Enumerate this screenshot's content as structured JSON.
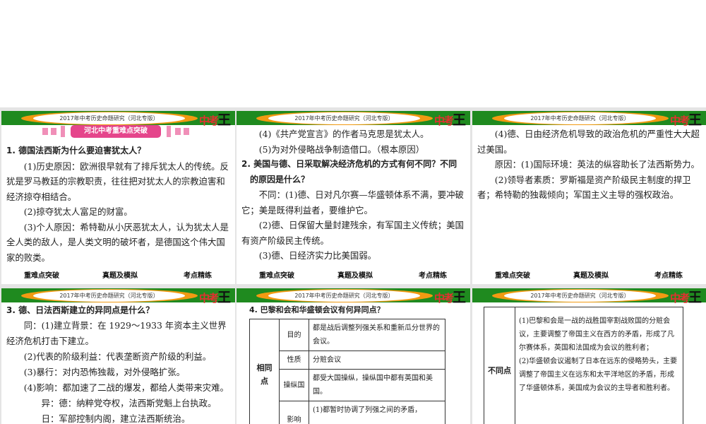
{
  "header_title": "2017年中考历史命题研究（河北专版）",
  "logo_text": {
    "a": "中考",
    "b": "王"
  },
  "footer": {
    "nav1": "重难点突破",
    "nav2": "真题及模拟",
    "nav3": "考点精练"
  },
  "slide1": {
    "banner": "河北中考重难点突破",
    "q": "1. 德国法西斯为什么要迫害犹太人？",
    "p1": "(1)历史原因：欧洲很早就有了排斥犹太人的传统。反犹是罗马教廷的宗教职责，往往把对犹太人的宗教迫害和经济掠夺相结合。",
    "p2": "(2)掠夺犹太人富足的财富。",
    "p3": "(3)个人原因：希特勒从小厌恶犹太人，认为犹太人是全人类的敌人，是人类文明的破坏者，是德国这个伟大国家的败类。"
  },
  "slide2": {
    "p1": "(4)《共产党宣言》的作者马克思是犹太人。",
    "p2": "(5)为对外侵略战争制造借口。（根本原因）",
    "q": "2. 美国与德、日采取解决经济危机的方式有何不同？不同的原因是什么？",
    "p3": "不同：(1)德、日对凡尔赛—华盛顿体系不满，要冲破它；美是既得利益者，要维护它。",
    "p4": "(2)德、日保留大量封建残余，有军国主义传统；美国有资产阶级民主传统。",
    "p5": "(3)德、日经济实力比美国弱。"
  },
  "slide3": {
    "p1": "(4)德、日由经济危机导致的政治危机的严重性大大超过美国。",
    "p2": "原因：(1)国际环境：英法的纵容助长了法西斯势力。",
    "p3": "(2)领导者素质：罗斯福是资产阶级民主制度的捍卫者；希特勒的独裁倾向；军国主义主导的强权政治。"
  },
  "slide4": {
    "q": "3. 德、日法西斯建立的异同点是什么？",
    "p1": "同：(1)建立背景：在 1929～1933 年资本主义世界经济危机打击下建立。",
    "p2": "(2)代表的阶级利益：代表垄断资产阶级的利益。",
    "p3": "(3)暴行：对内恐怖独裁，对外侵略扩张。",
    "p4": "(4)影响：都加速了二战的爆发，都给人类带来灾难。",
    "p5": "异：德：纳粹党夺权，法西斯党魁上台执政。",
    "p6": "日：军部控制内阁，建立法西斯统治。"
  },
  "slide5": {
    "q": "4. 巴黎和会和华盛顿会议有何异同点？",
    "group": "相同点",
    "rows": [
      {
        "k": "目的",
        "v": "都是战后调整列强关系和重新瓜分世界的会议。"
      },
      {
        "k": "性质",
        "v": "分赃会议"
      },
      {
        "k": "操纵国",
        "v": "都受大国操纵，操纵国中都有英国和美国。"
      },
      {
        "k": "影响",
        "v": "(1)都暂时协调了列强之间的矛盾，"
      }
    ]
  },
  "slide6": {
    "group": "不同点",
    "v1": "(1)巴黎和会是一战的战胜国宰割战败国的分赃会议，主要调整了帝国主义在西方的矛盾，形成了凡尔赛体系，英国和法国成为会议的胜利者；",
    "v2": "(2)华盛顿会议遏制了日本在远东的侵略势头，主要调整了帝国主义在远东和太平洋地区的矛盾，形成了华盛顿体系，美国成为会议的主导者和胜利者。"
  }
}
